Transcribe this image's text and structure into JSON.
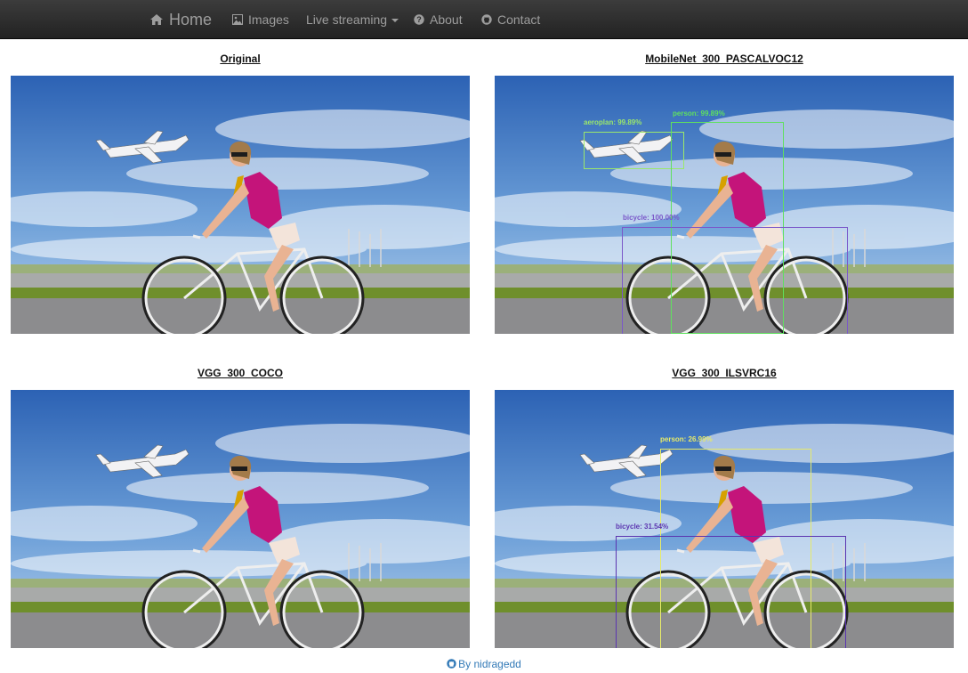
{
  "navbar": {
    "home": "Home",
    "images": "Images",
    "live_streaming": "Live streaming",
    "about": "About",
    "contact": "Contact"
  },
  "panels": [
    {
      "title": "Original",
      "detections": []
    },
    {
      "title": "MobileNet_300_PASCALVOC12",
      "detections": [
        {
          "label": "aeroplan: 99.89%",
          "color": "#9be86b"
        },
        {
          "label": "person: 99.89%",
          "color": "#5fe05f"
        },
        {
          "label": "bicycle: 100.00%",
          "color": "#7a57c9"
        }
      ]
    },
    {
      "title": "VGG_300_COCO",
      "detections": []
    },
    {
      "title": "VGG_300_ILSVRC16",
      "detections": [
        {
          "label": "person: 26.99%",
          "color": "#e6ea6a"
        },
        {
          "label": "bicycle: 31.54%",
          "color": "#5b35b0"
        }
      ]
    }
  ],
  "footer": {
    "credit": "By nidragedd"
  },
  "colors": {
    "navbar": "#222222",
    "link": "#337ab7"
  }
}
